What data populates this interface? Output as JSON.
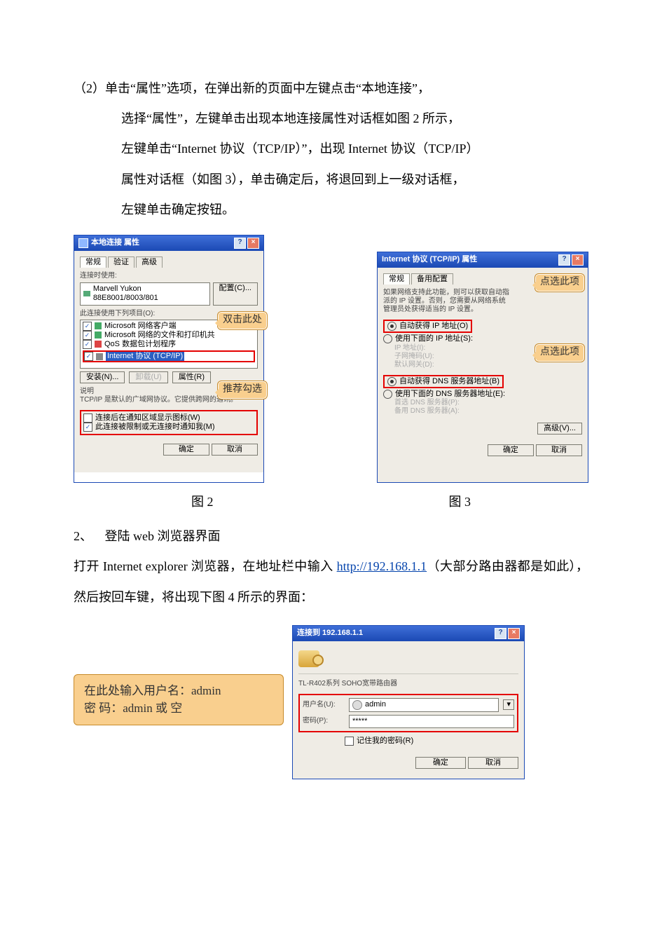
{
  "para1_leader": "（2）",
  "para1_l1": "单击“属性”选项，在弹出新的页面中左键点击“本地连接”，",
  "para1_l2": "选择“属性”，左键单击出现本地连接属性对话框如图 2 所示，",
  "para1_l3": "左键单击“Internet  协议（TCP/IP）”，出现 Internet  协议（TCP/IP）",
  "para1_l4": "属性对话框（如图 3），单击确定后，将退回到上一级对话框，",
  "para1_l5": "左键单击确定按钮。",
  "fig2": {
    "title": "本地连接 属性",
    "tabs": [
      "常规",
      "验证",
      "高级"
    ],
    "connect_using_label": "连接时使用:",
    "adapter": "Marvell Yukon 88E8001/8003/801",
    "config_btn": "配置(C)...",
    "uses_label": "此连接使用下列项目(O):",
    "items": [
      "Microsoft 网络客户端",
      "Microsoft 网络的文件和打印机共",
      "QoS 数据包计划程序"
    ],
    "tcpip": "Internet 协议 (TCP/IP)",
    "install_btn": "安装(N)...",
    "uninstall_btn": "卸载(U)",
    "props_btn": "属性(R)",
    "desc_label": "说明",
    "desc_text": "TCP/IP 是默认的广域网协议。它提供跨网的通讯。",
    "cb1": "连接后在通知区域显示图标(W)",
    "cb2": "此连接被限制或无连接时通知我(M)",
    "ok": "确定",
    "cancel": "取消",
    "callout_dblclick": "双击此处",
    "callout_recommend": "推荐勾选"
  },
  "fig3": {
    "title": "Internet 协议 (TCP/IP) 属性",
    "tabs": [
      "常规",
      "备用配置"
    ],
    "desc": "如果网络支持此功能，则可以获取自动指派的 IP 设置。否则，您需要从网络系统管理员处获得适当的 IP 设置。",
    "auto_ip": "自动获得 IP 地址(O)",
    "manual_ip": "使用下面的 IP 地址(S):",
    "ip_label": "IP 地址(I):",
    "mask_label": "子网掩码(U):",
    "gw_label": "默认网关(D):",
    "auto_dns": "自动获得 DNS 服务器地址(B)",
    "manual_dns": "使用下面的 DNS 服务器地址(E):",
    "dns1": "首选 DNS 服务器(P):",
    "dns2": "备用 DNS 服务器(A):",
    "adv_btn": "高级(V)...",
    "ok": "确定",
    "cancel": "取消",
    "callout_select": "点选此项"
  },
  "caption_fig2": "图 2",
  "caption_fig3": "图 3",
  "sec2_num": "2、",
  "sec2_title": "登陆 web 浏览器界面",
  "para2_a": "打开 Internet explorer 浏览器，在地址栏中输入 ",
  "para2_link": "http://192.168.1.1",
  "para2_b": "（大部分路由器都是如此），然后按回车键，将出现下图 4 所示的界面：",
  "fig4": {
    "title": "连接到 192.168.1.1",
    "product": "TL-R402系列 SOHO宽带路由器",
    "user_label": "用户名(U):",
    "pass_label": "密码(P):",
    "user_val": "admin",
    "pass_val": "*****",
    "remember": "记住我的密码(R)",
    "ok": "确定",
    "cancel": "取消"
  },
  "login_callout_l1": "在此处输入用户名：admin",
  "login_callout_l2": "密 码：admin 或 空"
}
